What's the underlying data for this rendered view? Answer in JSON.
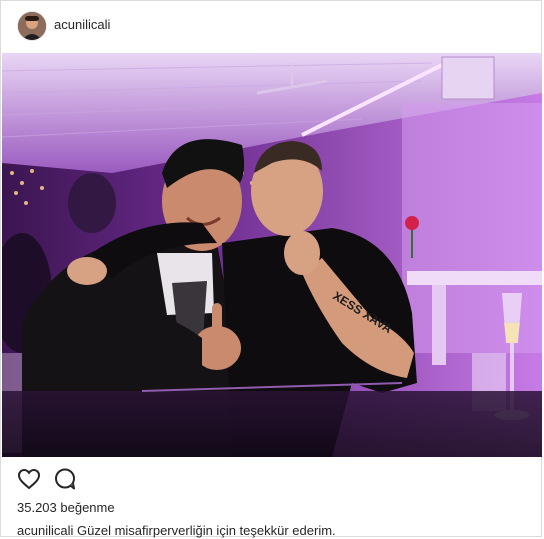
{
  "header": {
    "username": "acunilicali"
  },
  "actions": {
    "like_icon": "heart-icon",
    "comment_icon": "comment-icon"
  },
  "stats": {
    "likes": "35.203 beğenme"
  },
  "caption": {
    "username": "acunilicali",
    "text": "Güzel misafirperverliğin için teşekkür ederim."
  },
  "tattoo": {
    "text": "XESS XAVA"
  },
  "colors": {
    "photo_base": "#7a2fa0",
    "ceiling_light": "#f2b8ff"
  }
}
